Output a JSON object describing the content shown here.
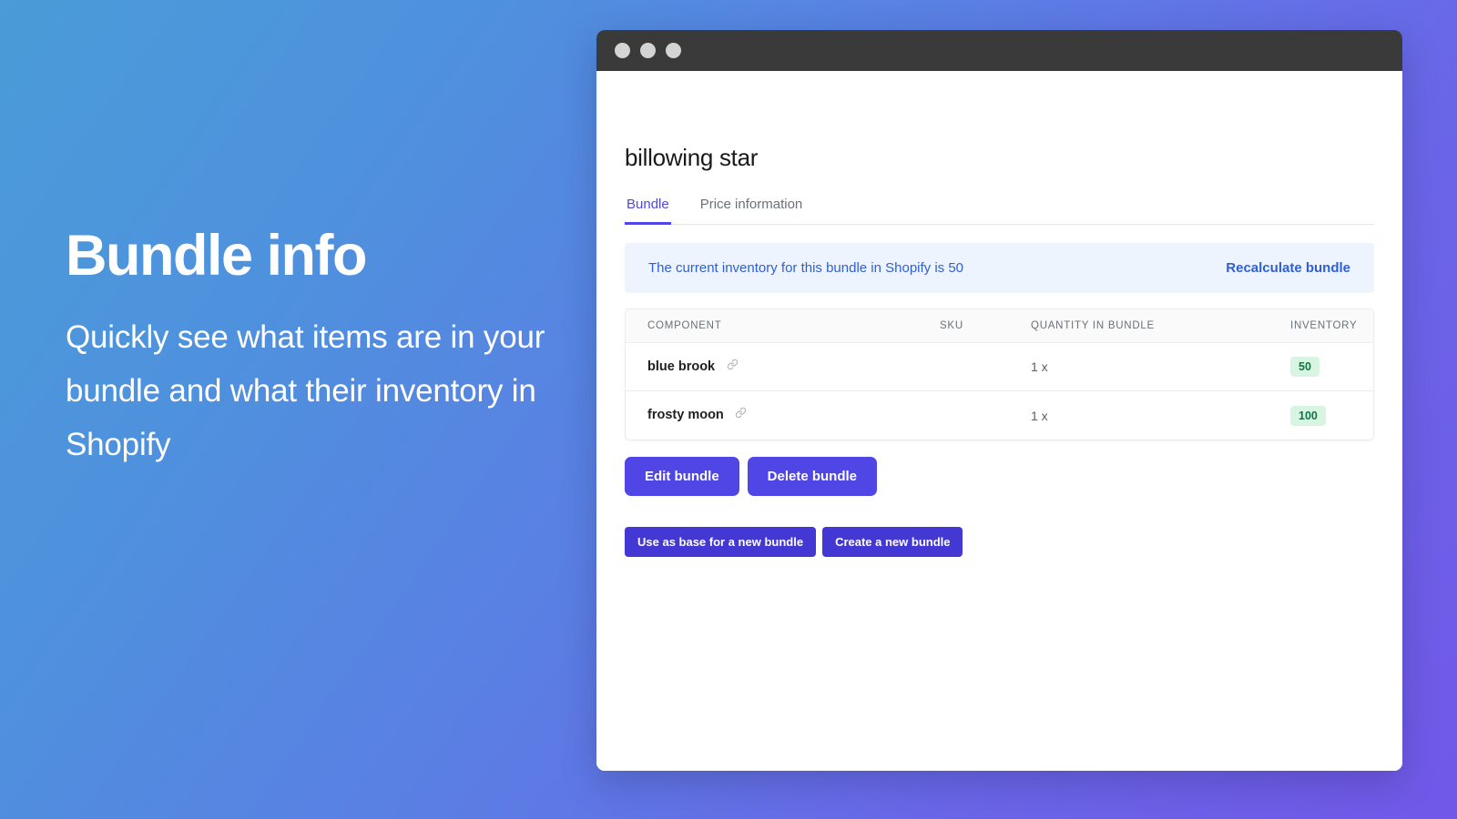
{
  "promo": {
    "title": "Bundle info",
    "subtitle": "Quickly see what items are in your bundle and what their inventory in Shopify"
  },
  "window": {
    "traffic_lights": [
      "close-dot",
      "minimize-dot",
      "maximize-dot"
    ]
  },
  "page": {
    "title": "billowing star"
  },
  "tabs": [
    {
      "label": "Bundle",
      "active": true
    },
    {
      "label": "Price information",
      "active": false
    }
  ],
  "banner": {
    "message": "The current inventory for this bundle in Shopify is 50",
    "action_label": "Recalculate bundle",
    "background": "#eef4fe",
    "text_color": "#2f5fd8"
  },
  "table": {
    "columns": [
      "COMPONENT",
      "SKU",
      "QUANTITY IN BUNDLE",
      "INVENTORY"
    ],
    "rows": [
      {
        "component": "blue brook",
        "icon": "link-icon",
        "sku": "",
        "quantity": "1 x",
        "inventory": "50"
      },
      {
        "component": "frosty moon",
        "icon": "link-icon",
        "sku": "",
        "quantity": "1 x",
        "inventory": "100"
      }
    ],
    "badge_bg": "#d7f5e0",
    "badge_text_color": "#157347"
  },
  "actions": {
    "primary": [
      {
        "label": "Edit bundle"
      },
      {
        "label": "Delete bundle"
      }
    ],
    "secondary": [
      {
        "label": "Use as base for a new bundle"
      },
      {
        "label": "Create a new bundle"
      }
    ],
    "accent_color": "#4f46e5"
  }
}
